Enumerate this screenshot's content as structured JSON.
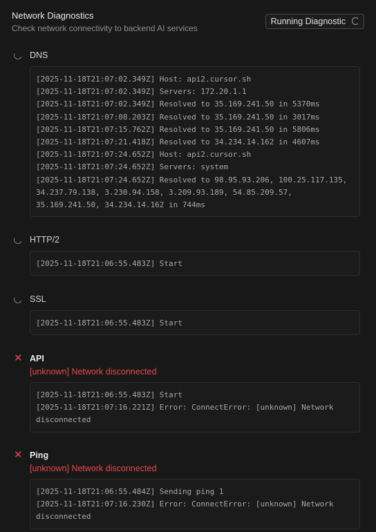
{
  "header": {
    "title": "Network Diagnostics",
    "subtitle": "Check network connectivity to backend AI services",
    "run_button_label": "Running Diagnostic"
  },
  "sections": [
    {
      "name": "DNS",
      "status": "running",
      "status_icon": "spinner-icon",
      "error": "",
      "logs": [
        "[2025-11-18T21:07:02.349Z] Host: api2.cursor.sh",
        "[2025-11-18T21:07:02.349Z] Servers: 172.20.1.1",
        "[2025-11-18T21:07:02.349Z] Resolved to 35.169.241.50 in 5370ms",
        "[2025-11-18T21:07:08.203Z] Resolved to 35.169.241.50 in 3017ms",
        "[2025-11-18T21:07:15.762Z] Resolved to 35.169.241.50 in 5806ms",
        "[2025-11-18T21:07:21.418Z] Resolved to 34.234.14.162 in 4607ms",
        "[2025-11-18T21:07:24.652Z] Host: api2.cursor.sh",
        "[2025-11-18T21:07:24.652Z] Servers: system",
        "[2025-11-18T21:07:24.652Z] Resolved to 98.95.93.206, 100.25.117.135,\n34.237.79.138, 3.230.94.158, 3.209.93.189, 54.85.209.57,\n35.169.241.50, 34.234.14.162 in 744ms"
      ]
    },
    {
      "name": "HTTP/2",
      "status": "running",
      "status_icon": "spinner-icon",
      "error": "",
      "logs": [
        "[2025-11-18T21:06:55.483Z] Start"
      ]
    },
    {
      "name": "SSL",
      "status": "running",
      "status_icon": "spinner-icon",
      "error": "",
      "logs": [
        "[2025-11-18T21:06:55.483Z] Start"
      ]
    },
    {
      "name": "API",
      "status": "error",
      "status_icon": "error-x-icon",
      "error": "[unknown] Network disconnected",
      "logs": [
        "[2025-11-18T21:06:55.483Z] Start",
        "[2025-11-18T21:07:16.221Z] Error: ConnectError: [unknown] Network\ndisconnected"
      ]
    },
    {
      "name": "Ping",
      "status": "error",
      "status_icon": "error-x-icon",
      "error": "[unknown] Network disconnected",
      "logs": [
        "[2025-11-18T21:06:55.484Z] Sending ping 1",
        "[2025-11-18T21:07:16.230Z] Error: ConnectError: [unknown] Network\ndisconnected"
      ]
    }
  ],
  "colors": {
    "background": "#181818",
    "log_background": "#1b1b1b",
    "error": "#e5484d",
    "text": "#cccccc",
    "muted": "#8e8e8e"
  }
}
